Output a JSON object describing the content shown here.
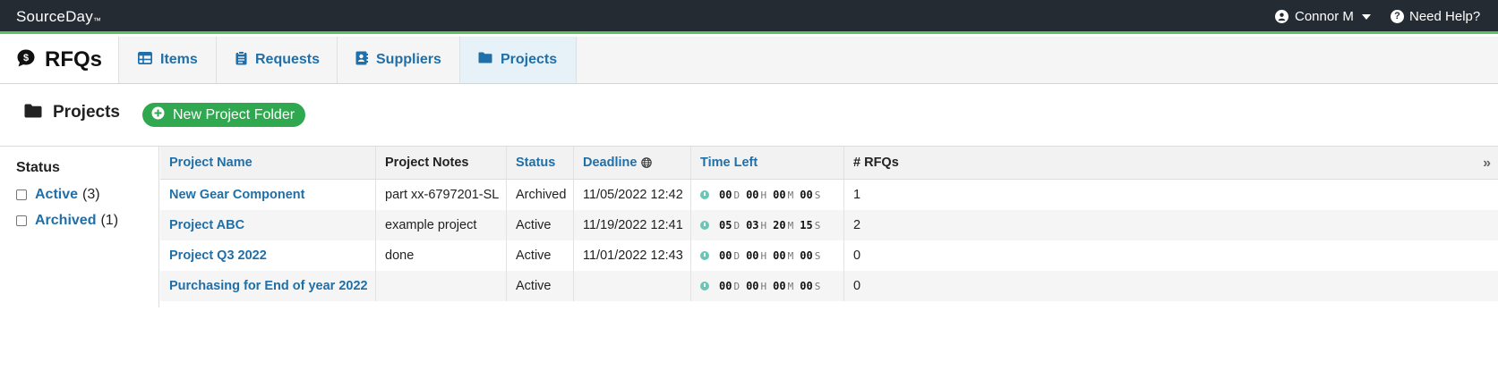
{
  "app": {
    "brand": "SourceDay",
    "brand_mark": "™"
  },
  "topbar": {
    "user": "Connor M",
    "help": "Need Help?"
  },
  "nav": {
    "title": "RFQs",
    "tabs": [
      {
        "label": "Items",
        "icon": "table-icon"
      },
      {
        "label": "Requests",
        "icon": "clipboard-icon"
      },
      {
        "label": "Suppliers",
        "icon": "contact-book-icon"
      },
      {
        "label": "Projects",
        "icon": "folder-icon",
        "active": true
      }
    ]
  },
  "page": {
    "title": "Projects",
    "new_button": "New Project Folder"
  },
  "sidebar": {
    "header": "Status",
    "filters": [
      {
        "label": "Active",
        "count": "(3)",
        "checked": false
      },
      {
        "label": "Archived",
        "count": "(1)",
        "checked": false
      }
    ]
  },
  "table": {
    "columns": {
      "name": "Project Name",
      "notes": "Project Notes",
      "status": "Status",
      "deadline": "Deadline",
      "time_left": "Time Left",
      "rfqs": "# RFQs"
    },
    "unit_labels": {
      "d": "D",
      "h": "H",
      "m": "M",
      "s": "S"
    },
    "rows": [
      {
        "name": "New Gear Component",
        "notes": "part xx-6797201-SL",
        "status": "Archived",
        "deadline": "11/05/2022 12:42",
        "d": "00",
        "h": "00",
        "m": "00",
        "s": "00",
        "rfqs": "1"
      },
      {
        "name": "Project ABC",
        "notes": "example project",
        "status": "Active",
        "deadline": "11/19/2022 12:41",
        "d": "05",
        "h": "03",
        "m": "20",
        "s": "15",
        "rfqs": "2"
      },
      {
        "name": "Project Q3 2022",
        "notes": "done",
        "status": "Active",
        "deadline": "11/01/2022 12:43",
        "d": "00",
        "h": "00",
        "m": "00",
        "s": "00",
        "rfqs": "0"
      },
      {
        "name": "Purchasing for End of year 2022",
        "notes": "",
        "status": "Active",
        "deadline": "",
        "d": "00",
        "h": "00",
        "m": "00",
        "s": "00",
        "rfqs": "0"
      }
    ]
  },
  "colors": {
    "topbar": "#252b33",
    "accent_green": "#2fa84f",
    "link_blue": "#1f6fa8",
    "timer_teal": "#6cc6b8"
  }
}
